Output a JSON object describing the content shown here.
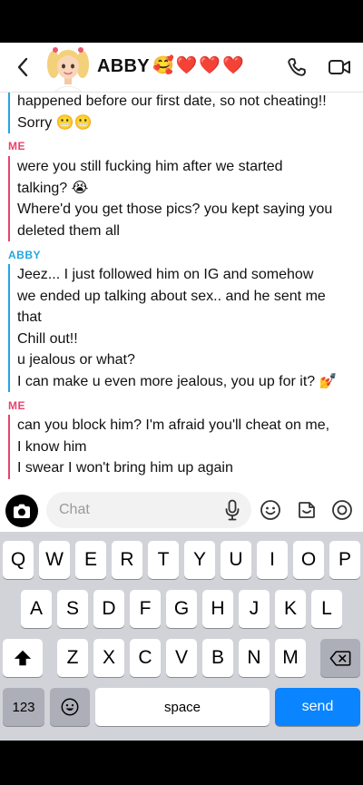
{
  "header": {
    "contact_name": "ABBY",
    "emojis": [
      "🥰",
      "❤️",
      "❤️",
      "❤️"
    ]
  },
  "messages": [
    {
      "sender": "",
      "side": "abby",
      "lines": [
        "happened before our first date, so not cheating!!",
        "Sorry 😬😬"
      ]
    },
    {
      "sender": "ME",
      "side": "me",
      "lines": [
        "were you still fucking him after we started",
        "talking? 😭",
        "Where'd you get those pics? you kept saying you",
        "deleted them all"
      ]
    },
    {
      "sender": "ABBY",
      "side": "abby",
      "lines": [
        "Jeez... I just followed him on IG and somehow",
        "we ended up talking about sex.. and he sent me",
        "that",
        "Chill out!!",
        "u jealous or what?",
        "I can make u even more jealous, you up for it? 💅"
      ]
    },
    {
      "sender": "ME",
      "side": "me",
      "lines": [
        "can you block him? I'm afraid you'll cheat on me,",
        "I know him",
        "I swear I won't bring him up again"
      ]
    }
  ],
  "input": {
    "placeholder": "Chat"
  },
  "keyboard": {
    "row1": [
      "Q",
      "W",
      "E",
      "R",
      "T",
      "Y",
      "U",
      "I",
      "O",
      "P"
    ],
    "row2": [
      "A",
      "S",
      "D",
      "F",
      "G",
      "H",
      "J",
      "K",
      "L"
    ],
    "row3": [
      "Z",
      "X",
      "C",
      "V",
      "B",
      "N",
      "M"
    ],
    "numbers_label": "123",
    "space_label": "space",
    "send_label": "send"
  },
  "colors": {
    "me": "#e5446d",
    "abby": "#22a7e0",
    "send": "#0a84ff"
  }
}
